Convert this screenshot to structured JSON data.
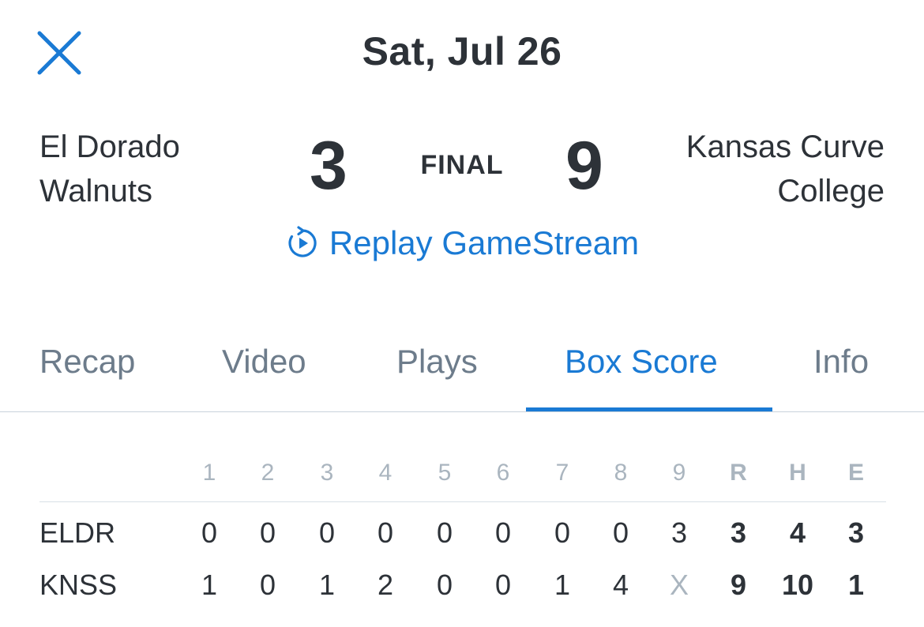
{
  "header": {
    "date": "Sat, Jul 26"
  },
  "game": {
    "away": {
      "name_line1": "El Dorado",
      "name_line2": "Walnuts",
      "score": "3"
    },
    "home": {
      "name_line1": "Kansas Curve",
      "name_line2": "College",
      "score": "9"
    },
    "status": "FINAL",
    "replay_label": "Replay GameStream"
  },
  "tabs": [
    {
      "label": "Recap",
      "active": false
    },
    {
      "label": "Video",
      "active": false
    },
    {
      "label": "Plays",
      "active": false
    },
    {
      "label": "Box Score",
      "active": true
    },
    {
      "label": "Info",
      "active": false
    }
  ],
  "box_score": {
    "innings": [
      "1",
      "2",
      "3",
      "4",
      "5",
      "6",
      "7",
      "8",
      "9"
    ],
    "totals_headers": [
      "R",
      "H",
      "E"
    ],
    "rows": [
      {
        "team": "ELDR",
        "innings": [
          "0",
          "0",
          "0",
          "0",
          "0",
          "0",
          "0",
          "0",
          "3"
        ],
        "totals": [
          "3",
          "4",
          "3"
        ]
      },
      {
        "team": "KNSS",
        "innings": [
          "1",
          "0",
          "1",
          "2",
          "0",
          "0",
          "1",
          "4",
          "X"
        ],
        "totals": [
          "9",
          "10",
          "1"
        ]
      }
    ]
  },
  "colors": {
    "accent": "#1a7ad4",
    "text": "#2d3238",
    "muted": "#aab5bf",
    "tab_inactive": "#6d7c8b"
  },
  "icons": {
    "close": "close-icon",
    "replay": "replay-icon"
  }
}
